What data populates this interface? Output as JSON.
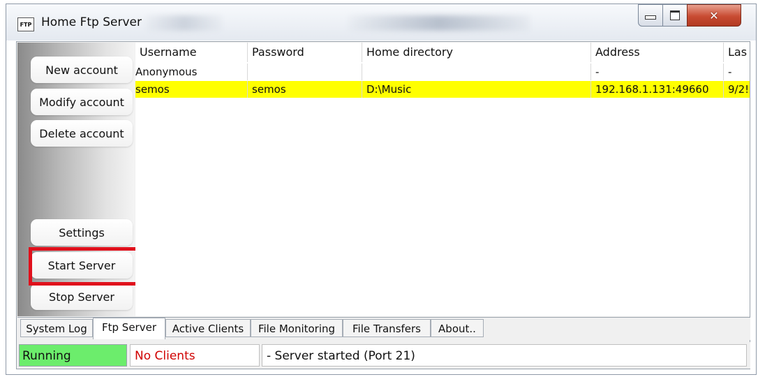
{
  "window": {
    "icon_text": "FTP",
    "title": "Home Ftp Server"
  },
  "sidebar": {
    "new_account": "New account",
    "modify_account": "Modify account",
    "delete_account": "Delete account",
    "settings": "Settings",
    "start_server": "Start Server",
    "stop_server": "Stop Server"
  },
  "table": {
    "columns": [
      "Username",
      "Password",
      "Home directory",
      "Address",
      "Las"
    ],
    "rows": [
      {
        "username": "Anonymous",
        "password": "",
        "home": "",
        "address": "-",
        "last": "-",
        "highlighted": false
      },
      {
        "username": "semos",
        "password": "semos",
        "home": "D:\\Music",
        "address": "192.168.1.131:49660",
        "last": "9/2!",
        "highlighted": true
      }
    ]
  },
  "tabs": [
    "System Log",
    "Ftp Server",
    "Active Clients",
    "File Monitoring",
    "File Transfers",
    "About.."
  ],
  "active_tab": "Ftp Server",
  "status": {
    "state": "Running",
    "clients": "No Clients",
    "message": "- Server started (Port 21)"
  },
  "colors": {
    "highlight_row": "#ffff00",
    "running": "#6ced6c",
    "no_clients_text": "#d00000",
    "annotation_box": "#e0101c"
  }
}
